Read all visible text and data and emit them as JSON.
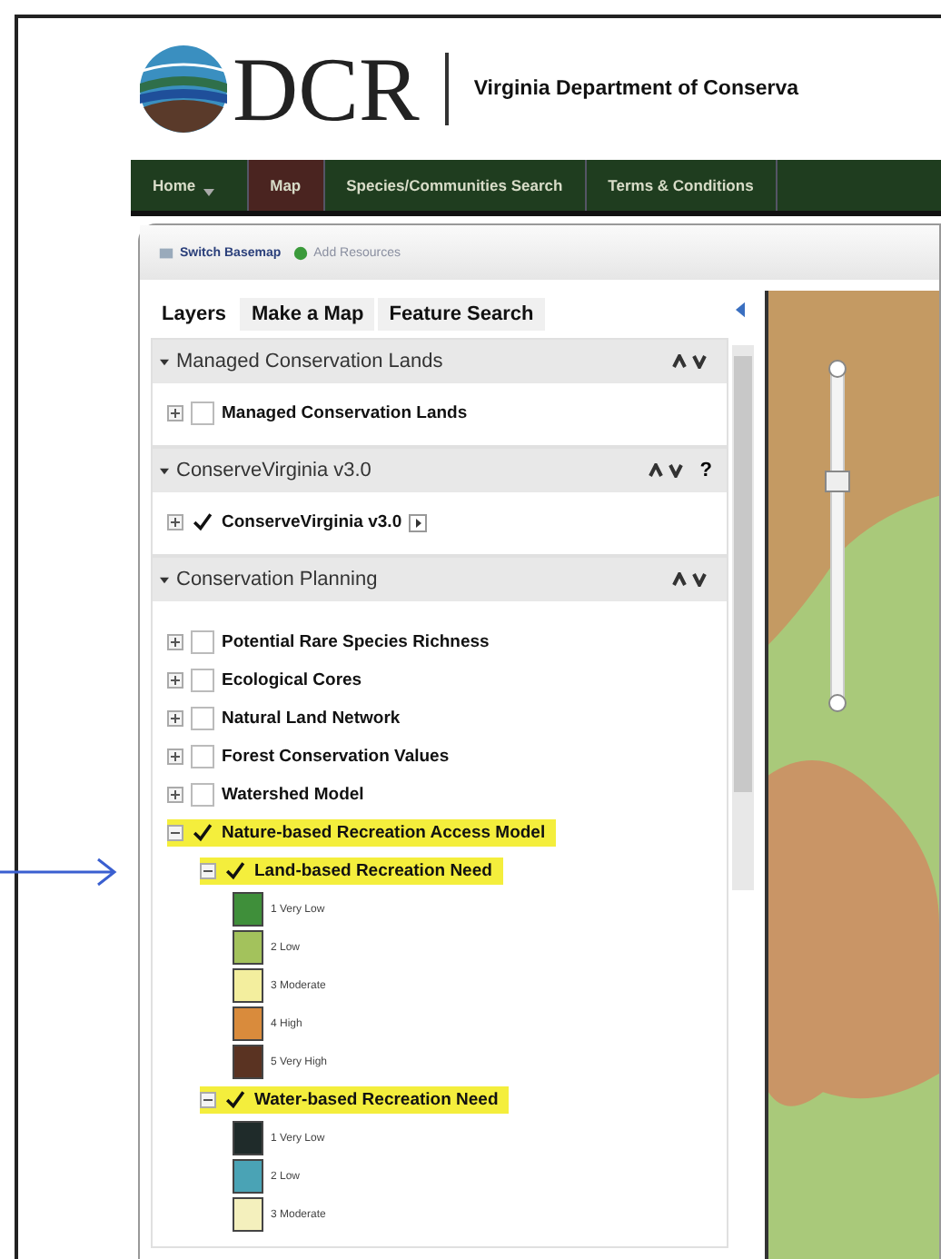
{
  "header": {
    "logo_text": "DCR",
    "org_name": "Virginia Department of Conserva"
  },
  "nav": [
    {
      "label": "Home",
      "dropdown": true,
      "selected": false
    },
    {
      "label": "Map",
      "dropdown": false,
      "selected": true
    },
    {
      "label": "Species/Communities Search",
      "dropdown": false,
      "selected": false
    },
    {
      "label": "Terms & Conditions",
      "dropdown": false,
      "selected": false
    }
  ],
  "toolbar": [
    {
      "label": "Switch Basemap",
      "kind": "basemap"
    },
    {
      "label": "Add Resources",
      "kind": "add"
    }
  ],
  "panel_tabs": [
    {
      "label": "Layers",
      "selected": true
    },
    {
      "label": "Make a Map",
      "selected": false
    },
    {
      "label": "Feature Search",
      "selected": false
    }
  ],
  "groups": [
    {
      "title": "Managed Conservation Lands",
      "expanded": true,
      "layers": [
        {
          "label": "Managed Conservation Lands",
          "checked": false,
          "expanded": false,
          "highlighted": false,
          "info": false
        }
      ]
    },
    {
      "title": "ConserveVirginia v3.0",
      "expanded": true,
      "help": "?",
      "layers": [
        {
          "label": "ConserveVirginia v3.0",
          "checked": true,
          "expanded": false,
          "highlighted": false,
          "info": true
        }
      ]
    },
    {
      "title": "Conservation Planning",
      "expanded": true,
      "layers": [
        {
          "label": "Potential Rare Species Richness",
          "checked": false,
          "expanded": false,
          "highlighted": false,
          "info": false
        },
        {
          "label": "Ecological Cores",
          "checked": false,
          "expanded": false,
          "highlighted": false,
          "info": false
        },
        {
          "label": "Natural Land Network",
          "checked": false,
          "expanded": false,
          "highlighted": false,
          "info": false
        },
        {
          "label": "Forest Conservation Values",
          "checked": false,
          "expanded": false,
          "highlighted": false,
          "info": false
        },
        {
          "label": "Watershed Model",
          "checked": false,
          "expanded": false,
          "highlighted": false,
          "info": false
        },
        {
          "label": "Nature-based Recreation Access Model",
          "checked": true,
          "expanded": true,
          "highlighted": true,
          "info": false,
          "children": [
            {
              "label": "Land-based Recreation Need",
              "checked": true,
              "expanded": true,
              "highlighted": true,
              "legend": [
                {
                  "label": "1 Very Low",
                  "color": "#3f8f3a"
                },
                {
                  "label": "2 Low",
                  "color": "#a3c25c"
                },
                {
                  "label": "3 Moderate",
                  "color": "#f3ee9e"
                },
                {
                  "label": "4 High",
                  "color": "#d98b3c"
                },
                {
                  "label": "5 Very High",
                  "color": "#5a3322"
                }
              ]
            },
            {
              "label": "Water-based Recreation Need",
              "checked": true,
              "expanded": true,
              "highlighted": true,
              "legend": [
                {
                  "label": "1 Very Low",
                  "color": "#1f2b2a"
                },
                {
                  "label": "2 Low",
                  "color": "#4aa3b5"
                },
                {
                  "label": "3 Moderate",
                  "color": "#f4f0bd"
                }
              ]
            }
          ]
        }
      ]
    }
  ],
  "map": {
    "zoom_slider": {
      "level": 0.67
    }
  }
}
